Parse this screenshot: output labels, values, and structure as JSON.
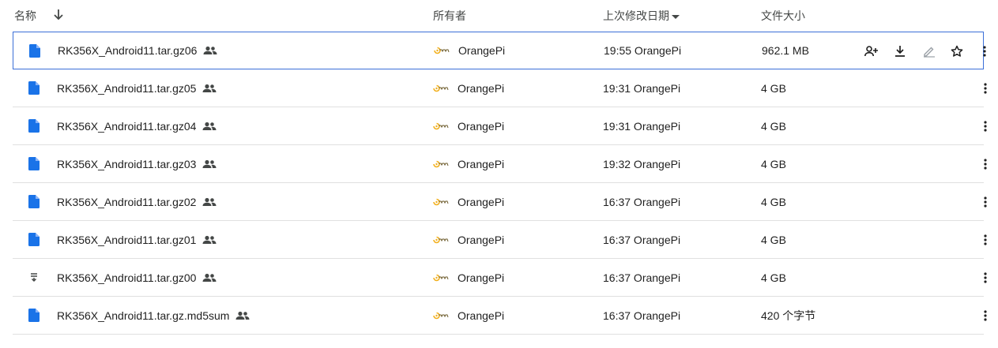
{
  "header": {
    "name": "名称",
    "owner": "所有者",
    "modified": "上次修改日期",
    "size": "文件大小"
  },
  "files": [
    {
      "name": "RK356X_Android11.tar.gz06",
      "owner": "OrangePi",
      "modified": "19:55 OrangePi",
      "size": "962.1 MB",
      "icon": "doc-icon",
      "selected": true
    },
    {
      "name": "RK356X_Android11.tar.gz05",
      "owner": "OrangePi",
      "modified": "19:31 OrangePi",
      "size": "4 GB",
      "icon": "doc-icon",
      "selected": false
    },
    {
      "name": "RK356X_Android11.tar.gz04",
      "owner": "OrangePi",
      "modified": "19:31 OrangePi",
      "size": "4 GB",
      "icon": "doc-icon",
      "selected": false
    },
    {
      "name": "RK356X_Android11.tar.gz03",
      "owner": "OrangePi",
      "modified": "19:32 OrangePi",
      "size": "4 GB",
      "icon": "doc-icon",
      "selected": false
    },
    {
      "name": "RK356X_Android11.tar.gz02",
      "owner": "OrangePi",
      "modified": "16:37 OrangePi",
      "size": "4 GB",
      "icon": "doc-icon",
      "selected": false
    },
    {
      "name": "RK356X_Android11.tar.gz01",
      "owner": "OrangePi",
      "modified": "16:37 OrangePi",
      "size": "4 GB",
      "icon": "doc-icon",
      "selected": false
    },
    {
      "name": "RK356X_Android11.tar.gz00",
      "owner": "OrangePi",
      "modified": "16:37 OrangePi",
      "size": "4 GB",
      "icon": "archive-icon",
      "selected": false
    },
    {
      "name": "RK356X_Android11.tar.gz.md5sum",
      "owner": "OrangePi",
      "modified": "16:37 OrangePi",
      "size": "420 个字节",
      "icon": "doc-icon",
      "selected": false
    }
  ],
  "colors": {
    "doc": "#1a73e8",
    "icon": "#444746",
    "selected_border": "#3b6fd8",
    "divider": "#e0e0e0",
    "avatar": "#f2b01e"
  }
}
